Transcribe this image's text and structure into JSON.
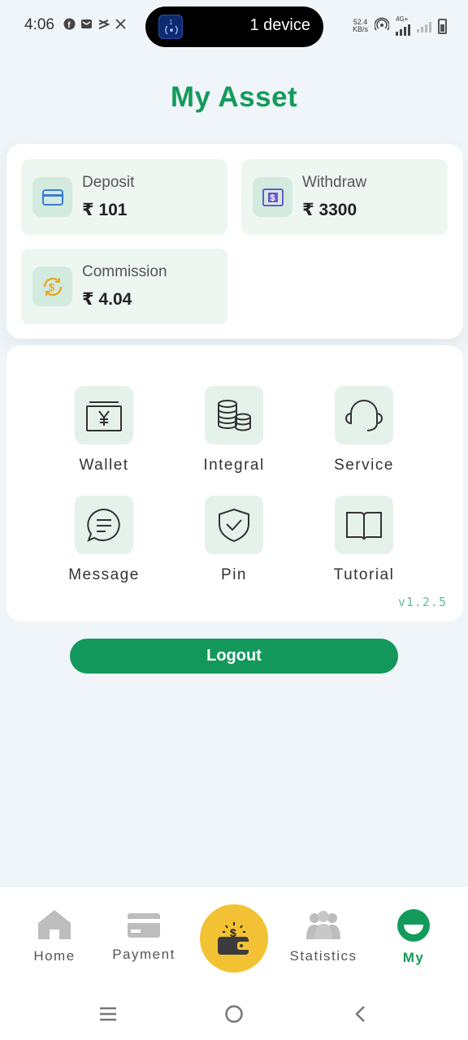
{
  "status_bar": {
    "time": "4:06",
    "pill_text": "1 device",
    "pill_badge": "1",
    "speed_value": "52.4",
    "speed_unit": "KB/s",
    "network": "4G+"
  },
  "page_title": "My Asset",
  "assets": {
    "deposit": {
      "label": "Deposit",
      "value": "₹ 101",
      "icon": "card-icon"
    },
    "withdraw": {
      "label": "Withdraw",
      "value": "₹ 3300",
      "icon": "cash-icon"
    },
    "commission": {
      "label": "Commission",
      "value": "₹ 4.04",
      "icon": "coin-exchange-icon"
    }
  },
  "menu": {
    "items": [
      {
        "label": "Wallet",
        "icon": "wallet-yen-icon"
      },
      {
        "label": "Integral",
        "icon": "coins-stack-icon"
      },
      {
        "label": "Service",
        "icon": "headset-icon"
      },
      {
        "label": "Message",
        "icon": "chat-bubble-icon"
      },
      {
        "label": "Pin",
        "icon": "shield-check-icon"
      },
      {
        "label": "Tutorial",
        "icon": "book-icon"
      }
    ],
    "version": "v1.2.5"
  },
  "logout_label": "Logout",
  "bottom_nav": {
    "items": [
      {
        "label": "Home",
        "icon": "home-icon"
      },
      {
        "label": "Payment",
        "icon": "payment-card-icon"
      },
      {
        "label": "",
        "icon": "wallet-money-icon"
      },
      {
        "label": "Statistics",
        "icon": "people-icon"
      },
      {
        "label": "My",
        "icon": "my-profile-icon"
      }
    ],
    "active": "My"
  },
  "colors": {
    "brand_green": "#149b5c",
    "background": "#f0f5f9",
    "center_yellow": "#f2c234"
  }
}
